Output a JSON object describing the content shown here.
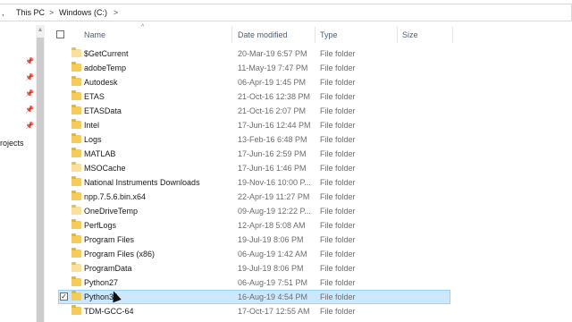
{
  "breadcrumb": {
    "lead": ",",
    "this_pc": "This PC",
    "drive": "Windows (C:)",
    "sep": ">"
  },
  "nav": {
    "pins": [
      "📌",
      "📌",
      "📌",
      "📌",
      "📌"
    ],
    "label": "rojects"
  },
  "columns": {
    "name": "Name",
    "date": "Date modified",
    "type": "Type",
    "size": "Size"
  },
  "rows": [
    {
      "name": "$GetCurrent",
      "date": "20-Mar-19 6:57 PM",
      "type": "File folder",
      "light": true
    },
    {
      "name": "adobeTemp",
      "date": "11-May-19 7:47 PM",
      "type": "File folder",
      "light": false
    },
    {
      "name": "Autodesk",
      "date": "06-Apr-19 1:45 PM",
      "type": "File folder",
      "light": false
    },
    {
      "name": "ETAS",
      "date": "21-Oct-16 12:38 PM",
      "type": "File folder",
      "light": false
    },
    {
      "name": "ETASData",
      "date": "21-Oct-16 2:07 PM",
      "type": "File folder",
      "light": false
    },
    {
      "name": "Intel",
      "date": "17-Jun-16 12:44 PM",
      "type": "File folder",
      "light": false
    },
    {
      "name": "Logs",
      "date": "13-Feb-16 6:48 PM",
      "type": "File folder",
      "light": false
    },
    {
      "name": "MATLAB",
      "date": "17-Jun-16 2:59 PM",
      "type": "File folder",
      "light": false
    },
    {
      "name": "MSOCache",
      "date": "17-Jun-16 1:46 PM",
      "type": "File folder",
      "light": true
    },
    {
      "name": "National Instruments Downloads",
      "date": "19-Nov-16 10:00 P...",
      "type": "File folder",
      "light": false
    },
    {
      "name": "npp.7.5.6.bin.x64",
      "date": "22-Apr-19 11:27 PM",
      "type": "File folder",
      "light": false
    },
    {
      "name": "OneDriveTemp",
      "date": "09-Aug-19 12:22 P...",
      "type": "File folder",
      "light": true
    },
    {
      "name": "PerfLogs",
      "date": "12-Apr-18 5:08 AM",
      "type": "File folder",
      "light": false
    },
    {
      "name": "Program Files",
      "date": "19-Jul-19 8:06 PM",
      "type": "File folder",
      "light": false
    },
    {
      "name": "Program Files (x86)",
      "date": "06-Aug-19 1:42 AM",
      "type": "File folder",
      "light": false
    },
    {
      "name": "ProgramData",
      "date": "19-Jul-19 8:06 PM",
      "type": "File folder",
      "light": true
    },
    {
      "name": "Python27",
      "date": "06-Aug-19 7:51 PM",
      "type": "File folder",
      "light": false
    },
    {
      "name": "Python34",
      "date": "16-Aug-19 4:54 PM",
      "type": "File folder",
      "light": false,
      "selected": true
    },
    {
      "name": "TDM-GCC-64",
      "date": "17-Oct-17 12:55 AM",
      "type": "File folder",
      "light": false
    }
  ],
  "checkbox_mark": "✓",
  "scroll_up_glyph": "▲",
  "sort_glyph": "^",
  "colors": {
    "folder": "#f4cc5a",
    "selection": "#cce8ff",
    "selection_border": "#99d1ff",
    "header_text": "#4c607a"
  }
}
